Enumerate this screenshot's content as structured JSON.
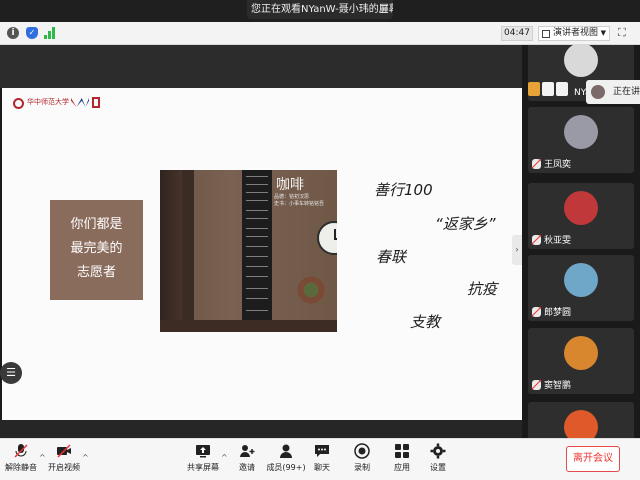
{
  "banner": {
    "text": "您正在观看NYanW-聂小玮的屏幕",
    "menu_icon": "hamburger-icon"
  },
  "toolbar": {
    "timer": "04:47",
    "view_mode": "演讲者视图",
    "icons": [
      "info-icon",
      "shield-icon",
      "signal-icon",
      "fullscreen-icon"
    ],
    "signal_color": "#2fb84c"
  },
  "slide": {
    "logo_text": "华中师范大学",
    "slogan": [
      "你们都是",
      "最完美的",
      "志愿者"
    ],
    "photo_title": "咖啡",
    "photo_subtitle": [
      "品德：铭初汉思",
      "史书：小事车转铭铭吾"
    ],
    "topics": [
      "善行100",
      "“返家乡”",
      "春联",
      "抗疫",
      "支教"
    ],
    "accent_color": "#8a6c5d"
  },
  "participants": {
    "self_name": "NYanW",
    "speaking_label": "正在讲",
    "list": [
      {
        "name": "王凤奕",
        "avatar_color": "#9a9aa6"
      },
      {
        "name": "秋亚雯",
        "avatar_color": "#c0383a"
      },
      {
        "name": "郎梦圆",
        "avatar_color": "#6fa7c9"
      },
      {
        "name": "窦智鹏",
        "avatar_color": "#d9872f"
      },
      {
        "name": "",
        "avatar_color": "#e0592a"
      }
    ]
  },
  "bottom": {
    "unmute": "解除静音",
    "start_video": "开启视频",
    "share_screen": "共享屏幕",
    "invite": "邀请",
    "members": "成员(99+)",
    "chat": "聊天",
    "record": "录制",
    "apps": "应用",
    "settings": "设置",
    "leave": "离开会议",
    "leave_color": "#e33333"
  }
}
